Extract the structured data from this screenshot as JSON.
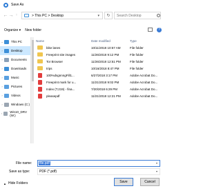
{
  "window": {
    "title": "Save As"
  },
  "address": {
    "path": "> This PC > Desktop",
    "search_placeholder": "Search Desktop"
  },
  "toolbar": {
    "organize": "Organize ▾",
    "new_folder": "New folder"
  },
  "sidebar": {
    "items": [
      {
        "label": "This PC",
        "icon": "computer-icon",
        "selected": false
      },
      {
        "label": "Desktop",
        "icon": "desktop-icon",
        "selected": true
      },
      {
        "label": "Documents",
        "icon": "documents-icon",
        "selected": false
      },
      {
        "label": "Downloads",
        "icon": "downloads-icon",
        "selected": false
      },
      {
        "label": "Music",
        "icon": "music-icon",
        "selected": false
      },
      {
        "label": "Pictures",
        "icon": "pictures-icon",
        "selected": false
      },
      {
        "label": "Videos",
        "icon": "videos-icon",
        "selected": false
      },
      {
        "label": "Windows (C:)",
        "icon": "drive-icon",
        "selected": false
      },
      {
        "label": "Win10_DRV (W:)",
        "icon": "drive-icon",
        "selected": false
      }
    ]
  },
  "file_list": {
    "columns": [
      "Name",
      "Date modified",
      "Type"
    ],
    "rows": [
      {
        "name": "bike lanes",
        "date": "10/11/2018 10:57 AM",
        "type": "File folder",
        "icon": "folder-icon"
      },
      {
        "name": "Freeprint site images",
        "date": "11/26/2018 9:12 PM",
        "type": "File folder",
        "icon": "folder-icon"
      },
      {
        "name": "Tor Browser",
        "date": "11/26/2018 12:51 PM",
        "type": "File folder",
        "icon": "folder-icon"
      },
      {
        "name": "trips",
        "date": "10/16/2018 8:47 PM",
        "type": "File folder",
        "icon": "folder-icon"
      },
      {
        "name": "100%dsgnnngFill1...",
        "date": "6/27/2018 3:17 PM",
        "type": "Adobe Acrobat Do...",
        "icon": "pdf-icon"
      },
      {
        "name": "Freeprint mark for u...",
        "date": "11/21/2018 9:02 PM",
        "type": "Adobe Acrobat Do...",
        "icon": "pdf-icon"
      },
      {
        "name": "Index (T.219) - fina...",
        "date": "7/20/2018 6:29 PM",
        "type": "Adobe Acrobat Do...",
        "icon": "pdf-icon"
      },
      {
        "name": "pleasepdf",
        "date": "11/21/2018 12:21 PM",
        "type": "Adobe Acrobat Do...",
        "icon": "pdf-icon"
      }
    ]
  },
  "save_form": {
    "file_name_label": "File name:",
    "file_name_value": "file.pdf",
    "save_type_label": "Save as type:",
    "save_type_value": "PDF (*.pdf)"
  },
  "footer": {
    "hide_folders": "Hide Folders",
    "save_button": "Save",
    "cancel_button": "Cancel"
  },
  "colors": {
    "accent": "#3a7bd5",
    "selection": "#cce8ff",
    "folder": "#f0c64f",
    "pdf": "#e23c3c"
  }
}
